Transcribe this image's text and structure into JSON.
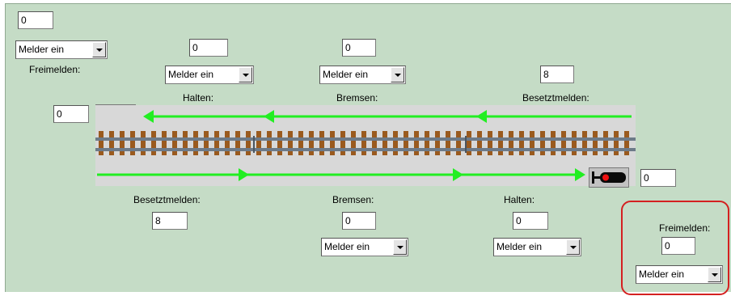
{
  "top_left": {
    "value": "0",
    "dropdown": "Melder ein",
    "label": "Freimelden:"
  },
  "left_signal": {
    "value": "0"
  },
  "right_signal": {
    "value": "0"
  },
  "top_track": {
    "halten": {
      "label": "Halten:",
      "value": "0",
      "dropdown": "Melder ein"
    },
    "bremsen": {
      "label": "Bremsen:",
      "value": "0",
      "dropdown": "Melder ein"
    },
    "besetztmelden": {
      "label": "Besetztmelden:",
      "value": "8"
    }
  },
  "bottom_track": {
    "besetztmelden": {
      "label": "Besetztmelden:",
      "value": "8"
    },
    "bremsen": {
      "label": "Bremsen:",
      "value": "0",
      "dropdown": "Melder ein"
    },
    "halten": {
      "label": "Halten:",
      "value": "0",
      "dropdown": "Melder ein"
    }
  },
  "bottom_right": {
    "label": "Freimelden:",
    "value": "0",
    "dropdown": "Melder ein"
  },
  "colors": {
    "arrow": "#22ee22",
    "highlight": "#d42020",
    "panel": "#c5dcc6",
    "signal_light": "#ee1111"
  },
  "icons": [
    "signal-left-icon",
    "signal-right-icon",
    "arrow-left-icon",
    "arrow-right-icon",
    "dropdown-arrow-icon"
  ]
}
